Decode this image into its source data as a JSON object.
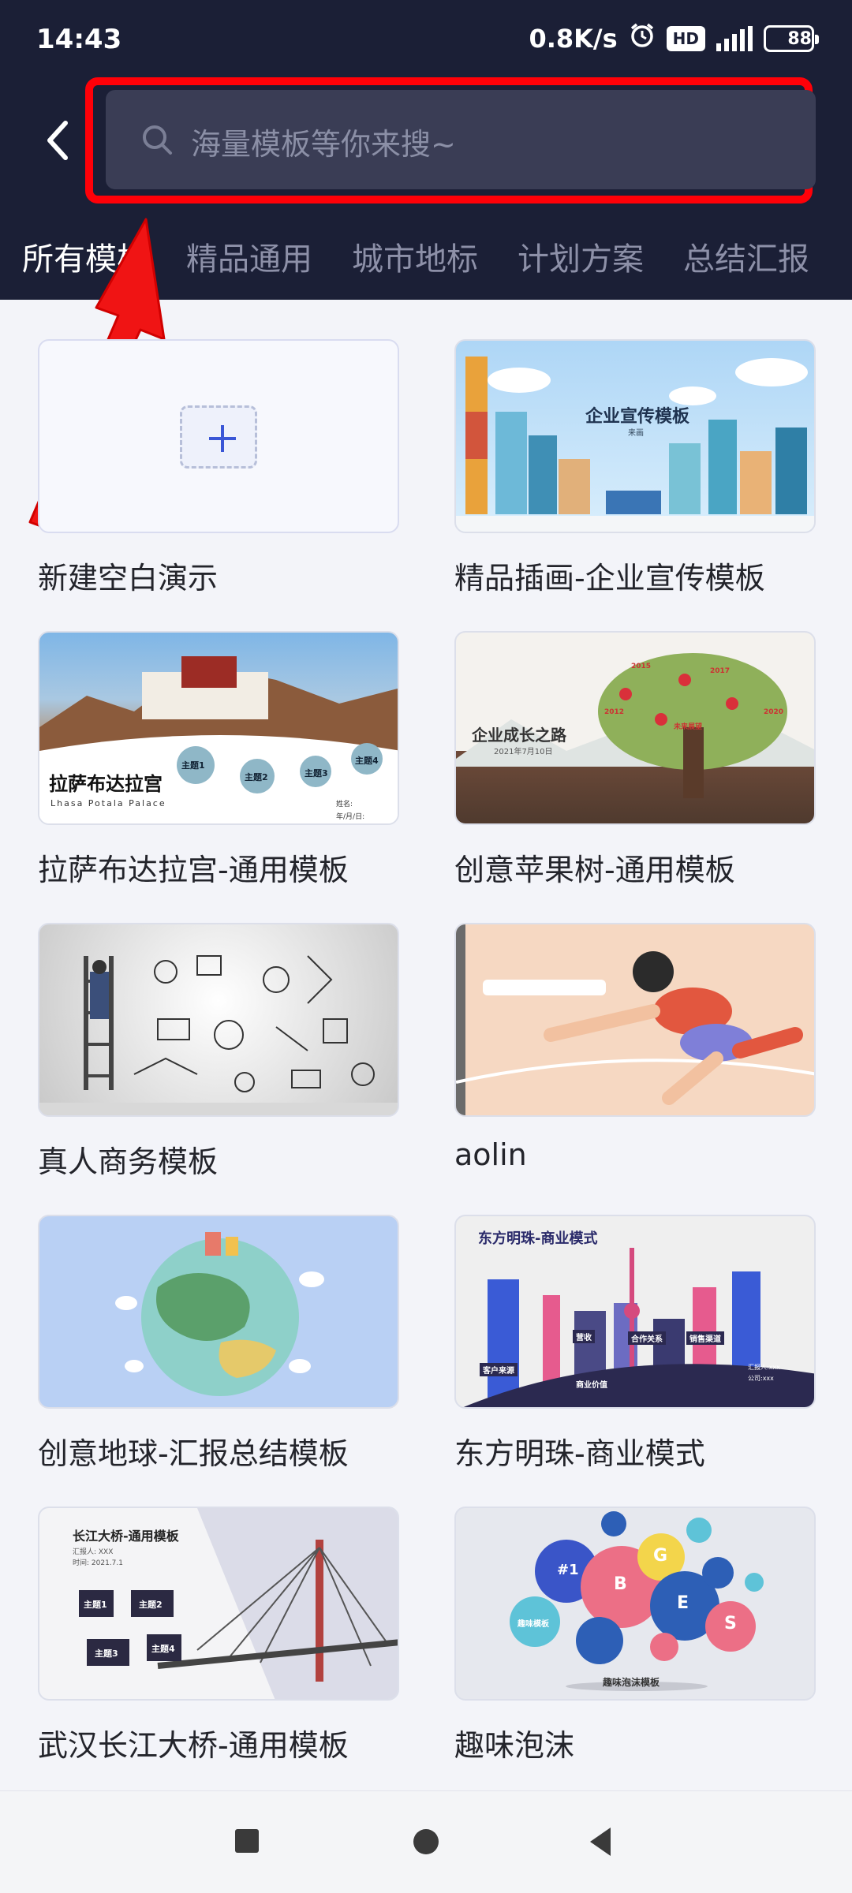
{
  "status_bar": {
    "time": "14:43",
    "network_speed": "0.8K/s",
    "hd_badge": "HD",
    "battery_level": "88",
    "icons": [
      "alarm-icon",
      "hd-icon",
      "signal-icon",
      "battery-icon"
    ]
  },
  "search": {
    "placeholder": "海量模板等你来搜~",
    "icon": "search-icon",
    "highlight_color": "#ff0008"
  },
  "tabs": [
    {
      "label": "所有模板",
      "active": true
    },
    {
      "label": "精品通用",
      "active": false
    },
    {
      "label": "城市地标",
      "active": false
    },
    {
      "label": "计划方案",
      "active": false
    },
    {
      "label": "总结汇报",
      "active": false
    }
  ],
  "templates": [
    {
      "title": "新建空白演示",
      "thumb_text": []
    },
    {
      "title": "精品插画-企业宣传模板",
      "thumb_text": [
        "企业宣传模板",
        "来画"
      ]
    },
    {
      "title": "拉萨布达拉宫-通用模板",
      "thumb_text": [
        "拉萨布达拉宫",
        "Lhasa Potala Palace",
        "主题1",
        "主题2",
        "主题3",
        "主题4",
        "姓名:",
        "年/月/日:"
      ]
    },
    {
      "title": "创意苹果树-通用模板",
      "thumb_text": [
        "企业成长之路",
        "2021年7月10日",
        "2015",
        "2017",
        "2012",
        "2020",
        "未来展望"
      ]
    },
    {
      "title": "真人商务模板",
      "thumb_text": []
    },
    {
      "title": "aolin",
      "thumb_text": []
    },
    {
      "title": "创意地球-汇报总结模板",
      "thumb_text": []
    },
    {
      "title": "东方明珠-商业模式",
      "thumb_text": [
        "东方明珠-商业模式",
        "客户来源",
        "营收",
        "合作关系",
        "销售渠道",
        "商业价值",
        "汇报人:xxx",
        "公司:xxx"
      ]
    },
    {
      "title": "武汉长江大桥-通用模板",
      "thumb_text": [
        "长江大桥-通用模板",
        "汇报人: XXX",
        "时间: 2021.7.1",
        "主题1",
        "主题2",
        "主题3",
        "主题4"
      ]
    },
    {
      "title": "趣味泡沫",
      "thumb_text": [
        "#1",
        "B",
        "G",
        "E",
        "S",
        "趣味模板",
        "趣味泡沫模板"
      ]
    }
  ],
  "colors": {
    "header_bg": "#1b1f36",
    "search_bg": "#3a3d55",
    "accent_red": "#ff0008",
    "page_bg": "#f3f4f9"
  },
  "nav": [
    "recents-square-icon",
    "home-circle-icon",
    "back-triangle-icon"
  ]
}
